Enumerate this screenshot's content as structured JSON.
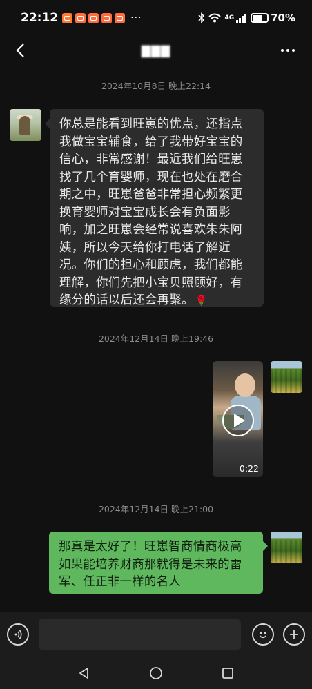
{
  "status_bar": {
    "time": "22:12",
    "more_notifications": "···",
    "network": "4G",
    "battery_text": "70%",
    "battery_level": 0.7
  },
  "nav": {
    "title": "▇▇▇"
  },
  "messages": [
    {
      "type": "timestamp",
      "text": "2024年10月8日 晚上22:14"
    },
    {
      "type": "text",
      "side": "left",
      "text": "你总是能看到旺崽的优点，还指点我做宝宝辅食，给了我带好宝宝的信心，非常感谢！最近我们给旺崽找了几个育婴师，现在也处在磨合期之中，旺崽爸爸非常担心频繁更换育婴师对宝宝成长会有负面影响，加之旺崽会经常说喜欢朱朱阿姨，所以今天给你打电话了解近况。你们的担心和顾虑，我们都能理解，你们先把小宝贝照顾好，有缘分的话以后还会再聚。",
      "emoji": "🌹"
    },
    {
      "type": "timestamp",
      "text": "2024年12月14日 晚上19:46"
    },
    {
      "type": "video",
      "side": "right",
      "duration": "0:22"
    },
    {
      "type": "timestamp",
      "text": "2024年12月14日 晚上21:00"
    },
    {
      "type": "text",
      "side": "right",
      "text": "那真是太好了！旺崽智商情商极高如果能培养财商那就得是未来的雷军、任正非一样的名人"
    }
  ],
  "input": {
    "value": "",
    "placeholder": ""
  },
  "colors": {
    "background": "#111111",
    "bubble_left": "#2c2c2c",
    "bubble_right": "#5fb85e",
    "timestamp": "#8a8a8a"
  },
  "icons": {
    "back": "chevron-left-icon",
    "more": "more-dots-icon",
    "voice": "voice-icon",
    "emoji": "emoji-icon",
    "plus": "plus-icon",
    "nav_back": "triangle-back-icon",
    "nav_home": "circle-home-icon",
    "nav_recent": "square-recent-icon"
  }
}
